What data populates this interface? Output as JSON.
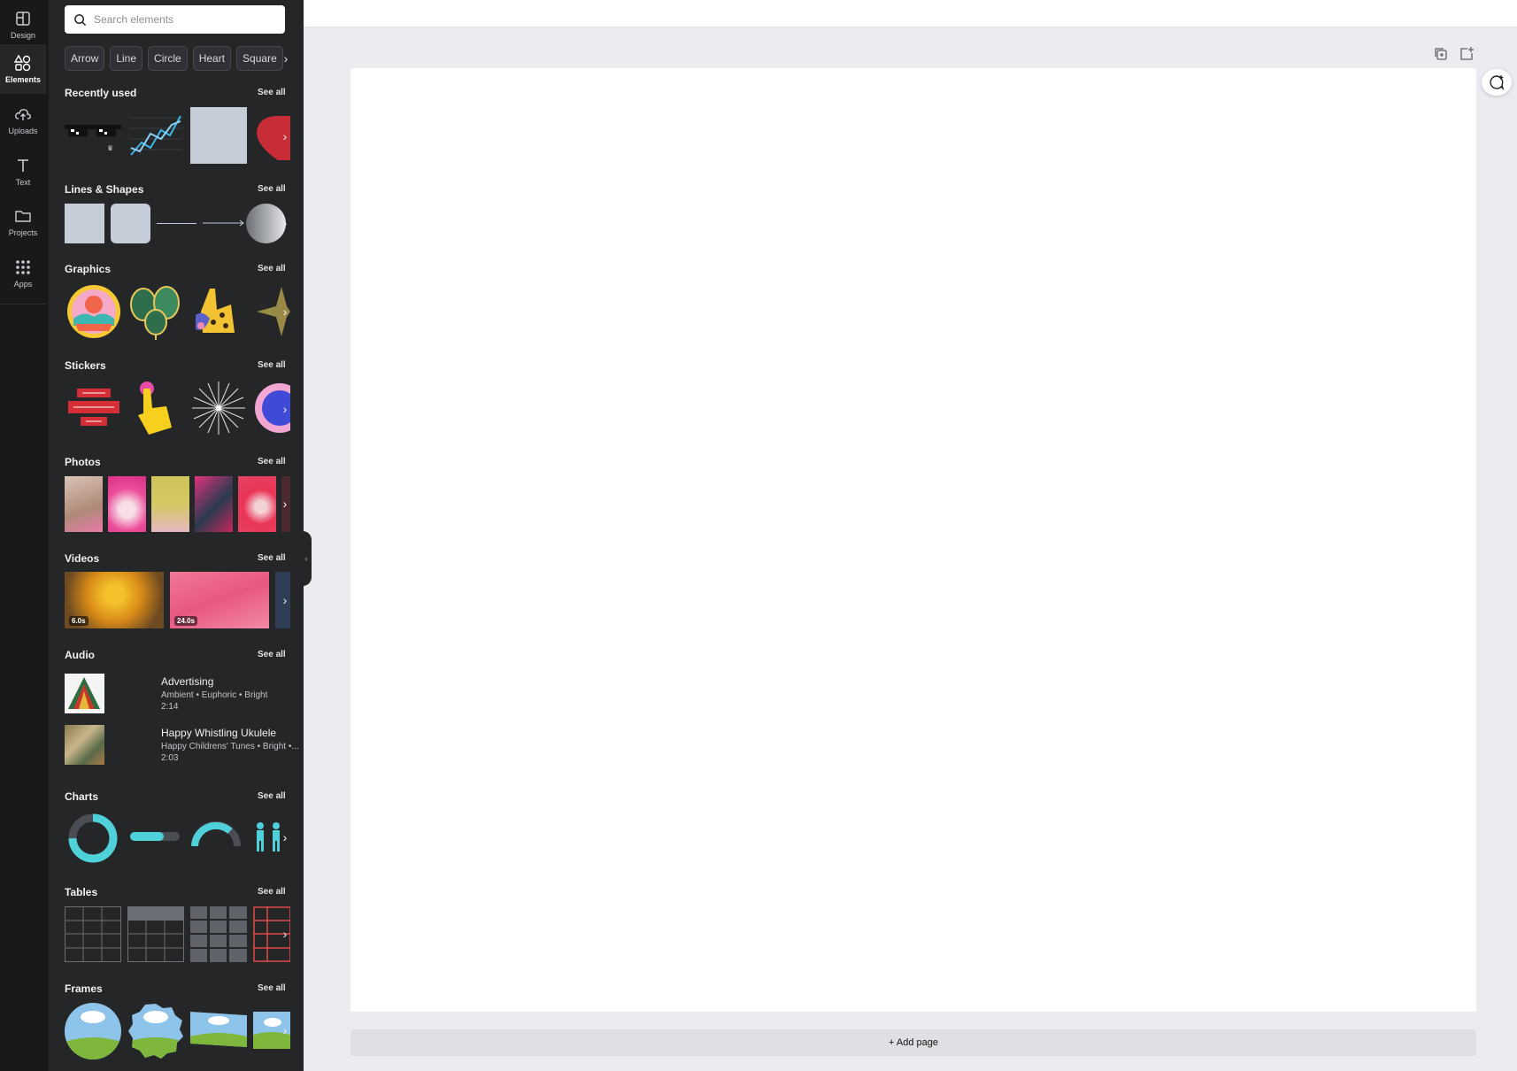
{
  "rail": {
    "items": [
      {
        "label": "Design",
        "icon": "layout-icon"
      },
      {
        "label": "Elements",
        "icon": "shapes-icon"
      },
      {
        "label": "Uploads",
        "icon": "cloud-upload-icon"
      },
      {
        "label": "Text",
        "icon": "text-icon"
      },
      {
        "label": "Projects",
        "icon": "folder-icon"
      },
      {
        "label": "Apps",
        "icon": "apps-grid-icon"
      }
    ],
    "active": "Elements"
  },
  "search": {
    "placeholder": "Search elements"
  },
  "chips": [
    "Arrow",
    "Line",
    "Circle",
    "Heart",
    "Square"
  ],
  "sections": {
    "recently_used": {
      "title": "Recently used",
      "see_all": "See all"
    },
    "lines_shapes": {
      "title": "Lines & Shapes",
      "see_all": "See all"
    },
    "graphics": {
      "title": "Graphics",
      "see_all": "See all"
    },
    "stickers": {
      "title": "Stickers",
      "see_all": "See all"
    },
    "photos": {
      "title": "Photos",
      "see_all": "See all"
    },
    "videos": {
      "title": "Videos",
      "see_all": "See all",
      "items": [
        {
          "duration": "6.0s"
        },
        {
          "duration": "24.0s"
        }
      ]
    },
    "audio": {
      "title": "Audio",
      "see_all": "See all",
      "items": [
        {
          "title": "Advertising",
          "tags": "Ambient • Euphoric • Bright",
          "duration": "2:14"
        },
        {
          "title": "Happy Whistling Ukulele",
          "tags": "Happy Childrens' Tunes • Bright •...",
          "duration": "2:03"
        }
      ]
    },
    "charts": {
      "title": "Charts",
      "see_all": "See all"
    },
    "tables": {
      "title": "Tables",
      "see_all": "See all"
    },
    "frames": {
      "title": "Frames",
      "see_all": "See all"
    }
  },
  "canvas": {
    "add_page": "+ Add page"
  },
  "colors": {
    "rail_bg": "#18191b",
    "panel_bg": "#252627",
    "canvas_bg": "#ebecf0",
    "accent_teal": "#4fd1d9"
  }
}
